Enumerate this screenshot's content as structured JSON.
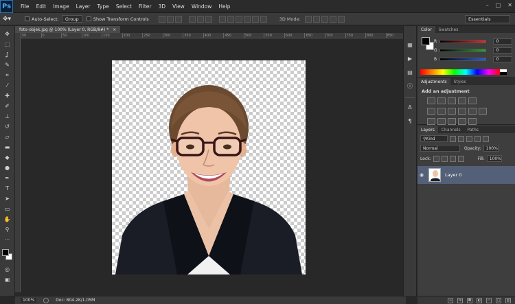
{
  "app": {
    "logo": "Ps"
  },
  "menu": [
    "File",
    "Edit",
    "Image",
    "Layer",
    "Type",
    "Select",
    "Filter",
    "3D",
    "View",
    "Window",
    "Help"
  ],
  "window_controls": [
    "–",
    "□",
    "✕"
  ],
  "options": {
    "auto_select_label": "Auto-Select:",
    "auto_select_value": "Group",
    "show_transform_label": "Show Transform Controls",
    "mode_3d_label": "3D Mode:",
    "workspace": "Essentials"
  },
  "document": {
    "tab_title": "foto-objek.jpg @ 100% (Layer 0, RGB/8#) *",
    "close": "×"
  },
  "ruler_ticks": [
    "50",
    "0",
    "50",
    "100",
    "150",
    "200",
    "250",
    "300",
    "350",
    "400",
    "450",
    "500",
    "550",
    "600",
    "650",
    "700",
    "750",
    "800",
    "850"
  ],
  "status": {
    "zoom": "100%",
    "doc": "Doc: 804.2K/1.05M"
  },
  "color_panel": {
    "tabs": [
      "Color",
      "Swatches"
    ],
    "rows": [
      {
        "label": "R",
        "value": "0",
        "color": "#e12a2a"
      },
      {
        "label": "G",
        "value": "0",
        "color": "#2aa534"
      },
      {
        "label": "B",
        "value": "0",
        "color": "#2a5ad8"
      }
    ]
  },
  "adjustments_panel": {
    "tabs": [
      "Adjustments",
      "Styles"
    ],
    "title": "Add an adjustment"
  },
  "layers_panel": {
    "tabs": [
      "Layers",
      "Channels",
      "Paths"
    ],
    "kind": "Kind",
    "blend_mode": "Normal",
    "opacity_label": "Opacity:",
    "opacity_value": "100%",
    "lock_label": "Lock:",
    "fill_label": "Fill:",
    "fill_value": "100%",
    "layers": [
      {
        "name": "Layer 0",
        "visible": true
      }
    ],
    "footer_icons": [
      "fx"
    ]
  }
}
